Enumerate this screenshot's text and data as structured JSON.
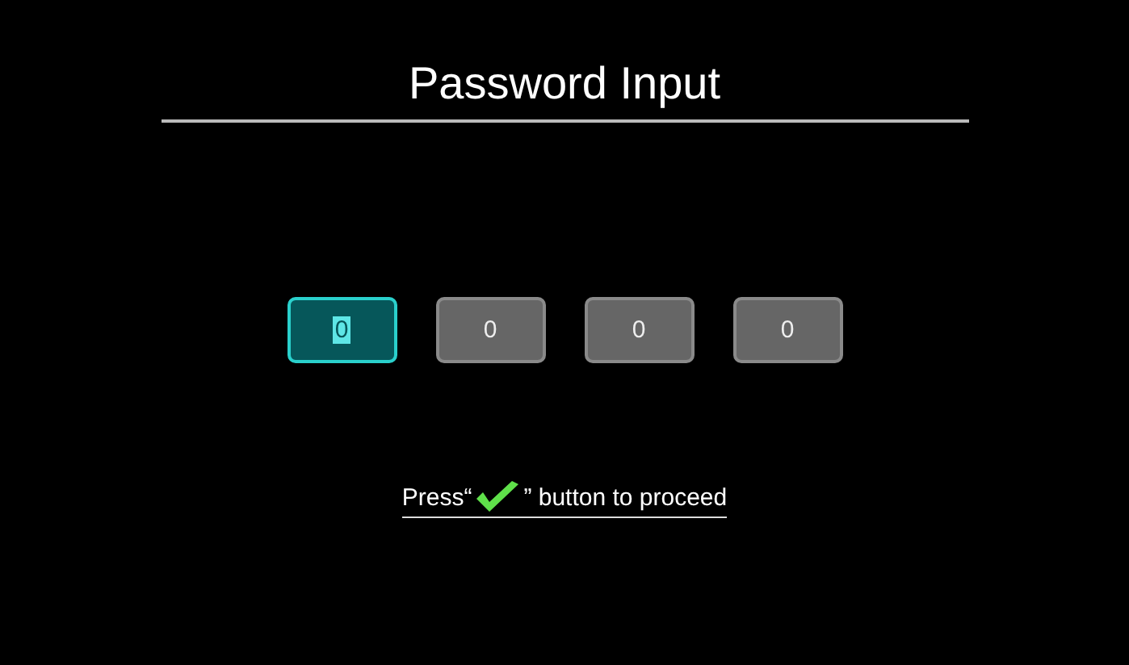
{
  "title": "Password Input",
  "digits": [
    {
      "value": "0",
      "selected": true
    },
    {
      "value": "0",
      "selected": false
    },
    {
      "value": "0",
      "selected": false
    },
    {
      "value": "0",
      "selected": false
    }
  ],
  "hint": {
    "before": "Press“",
    "after": "” button to proceed"
  }
}
